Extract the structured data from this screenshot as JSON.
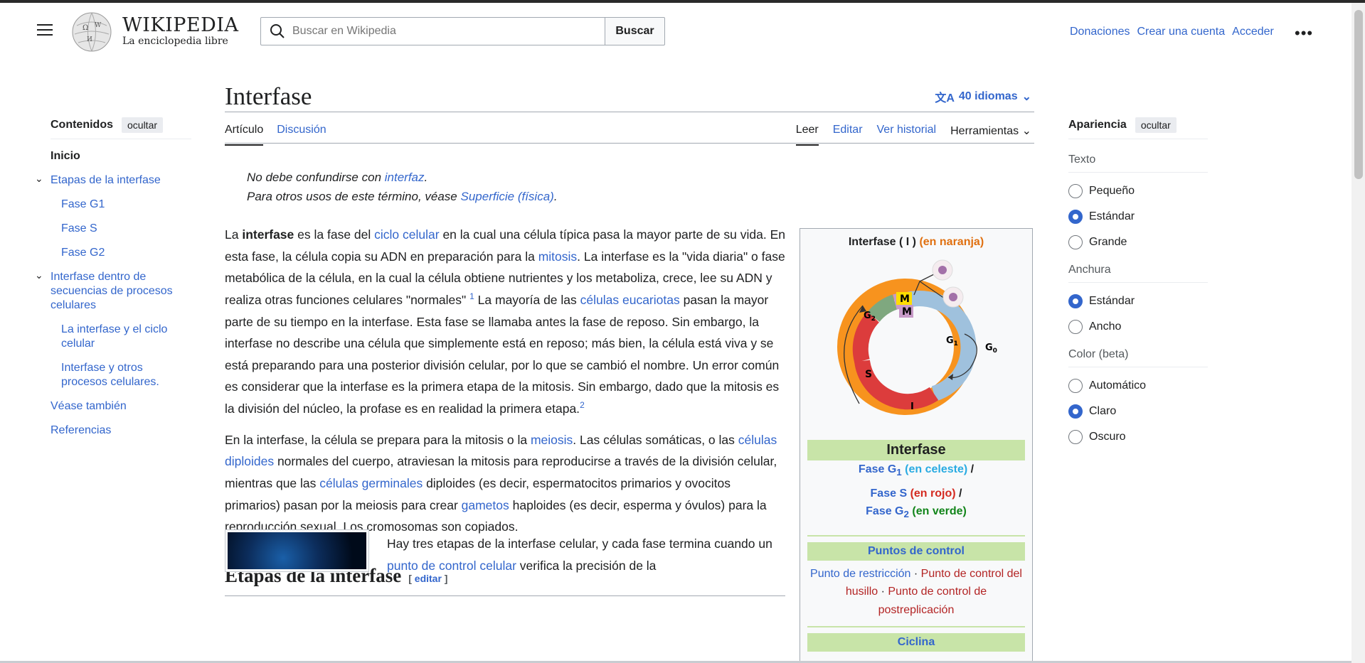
{
  "header": {
    "wordmark": "WIKIPEDIA",
    "tagline": "La enciclopedia libre",
    "search_placeholder": "Buscar en Wikipedia",
    "search_button": "Buscar",
    "user_links": [
      "Donaciones",
      "Crear una cuenta",
      "Acceder"
    ],
    "more_label": "•••"
  },
  "sidebar": {
    "title": "Contenidos",
    "hide_label": "ocultar",
    "items": {
      "inicio": "Inicio",
      "etapas": "Etapas de la interfase",
      "g1": "Fase G1",
      "s": "Fase S",
      "g2": "Fase G2",
      "dentro": "Interfase dentro de secuencias de procesos celulares",
      "ciclo": "La interfase y el ciclo celular",
      "otros": "Interfase y otros procesos celulares.",
      "vease": "Véase también",
      "refs": "Referencias"
    }
  },
  "article": {
    "title": "Interfase",
    "languages": "40 idiomas",
    "tabs_left": {
      "articulo": "Artículo",
      "discusion": "Discusión"
    },
    "tabs_right": {
      "leer": "Leer",
      "editar": "Editar",
      "historial": "Ver historial",
      "herramientas": "Herramientas"
    },
    "hatnote1_text": "No debe confundirse con ",
    "hatnote1_link": "interfaz",
    "hatnote2_text": "Para otros usos de este término, véase ",
    "hatnote2_link": "Superficie (física)",
    "p1": {
      "t1": "La ",
      "b1": "interfase",
      "t2": " es la fase del ",
      "l1": "ciclo celular",
      "t3": " en la cual una célula típica pasa la mayor parte de su vida. En esta fase, la célula copia su ADN en preparación para la ",
      "l2": "mitosis",
      "t4": ". La interfase es la \"vida diaria\" o fase metabólica de la célula, en la cual la célula obtiene nutrientes y los metaboliza, crece, lee su ADN y realiza otras funciones celulares \"normales\" ",
      "sup1": "1",
      "t5": "  La mayoría de las ",
      "l3": "células eucariotas",
      "t6": " pasan la mayor parte de su tiempo en la interfase. Esta fase se llamaba antes la fase de reposo. Sin embargo, la interfase no describe una célula que simplemente está en reposo; más bien, la célula está viva y se está preparando para una posterior división celular, por lo que se cambió el nombre. Un error común es considerar que la interfase es la primera etapa de la mitosis. Sin embargo, dado que la mitosis es la división del núcleo, la profase es en realidad la primera etapa.",
      "sup2": "2"
    },
    "p2": {
      "t1": "En la interfase, la célula se prepara para la mitosis o la ",
      "l1": "meiosis",
      "t2": ". Las células somáticas, o las ",
      "l2": "células diploides",
      "t3": " normales del cuerpo, atraviesan la mitosis para reproducirse a través de la división celular, mientras que las ",
      "l3": "células germinales",
      "t4": " diploides (es decir, espermatocitos primarios y ovocitos primarios) pasan por la meiosis para crear ",
      "l4": "gametos",
      "t5": " haploides (es decir, esperma y óvulos) para la reproducción sexual. Los cromosomas son copiados."
    },
    "h2": "Etapas de la interfase",
    "h2_edit": "editar",
    "stages_text1": "Hay tres etapas de la interfase celular, y cada fase termina cuando un ",
    "stages_link": "punto de control celular",
    "stages_text2": " verifica la precisión de la"
  },
  "infobox": {
    "title_a": "Interfase ( ",
    "title_i": "I",
    "title_b": " ) ",
    "title_orange": "(en naranja)",
    "diagram_labels": {
      "m_outer": "M",
      "m_inner": "M",
      "g2": "G",
      "g2_sub": "2",
      "g1": "G",
      "g1_sub": "1",
      "g0": "G",
      "g0_sub": "0",
      "s": "S",
      "i": "I"
    },
    "band": "Interfase",
    "fase_g1_a": "Fase G",
    "fase_g1_sub": "1",
    "fase_g1_paren": " (en celeste)",
    "fase_s": "Fase S",
    "fase_s_paren": " (en rojo)",
    "fase_g2_a": "Fase G",
    "fase_g2_sub": "2",
    "fase_g2_paren": " (en verde)",
    "slash": " /",
    "puntos": "Puntos de control",
    "pc1": "Punto de restricción",
    "pc2": "Punto de control del husillo",
    "pc3": "Punto de control de postreplicación",
    "dot": " · ",
    "ciclina": "Ciclina",
    "colors": {
      "orange": "#f7931e",
      "cyan": "#9fc1dd",
      "red": "#dc3c3c",
      "green": "#7fa87f",
      "mitosis": "#ffdd00",
      "band": "#c8e4a8"
    }
  },
  "appearance": {
    "title": "Apariencia",
    "hide_label": "ocultar",
    "texto": "Texto",
    "texto_opts": [
      "Pequeño",
      "Estándar",
      "Grande"
    ],
    "anchura": "Anchura",
    "anchura_opts": [
      "Estándar",
      "Ancho"
    ],
    "color": "Color (beta)",
    "color_opts": [
      "Automático",
      "Claro",
      "Oscuro"
    ]
  }
}
